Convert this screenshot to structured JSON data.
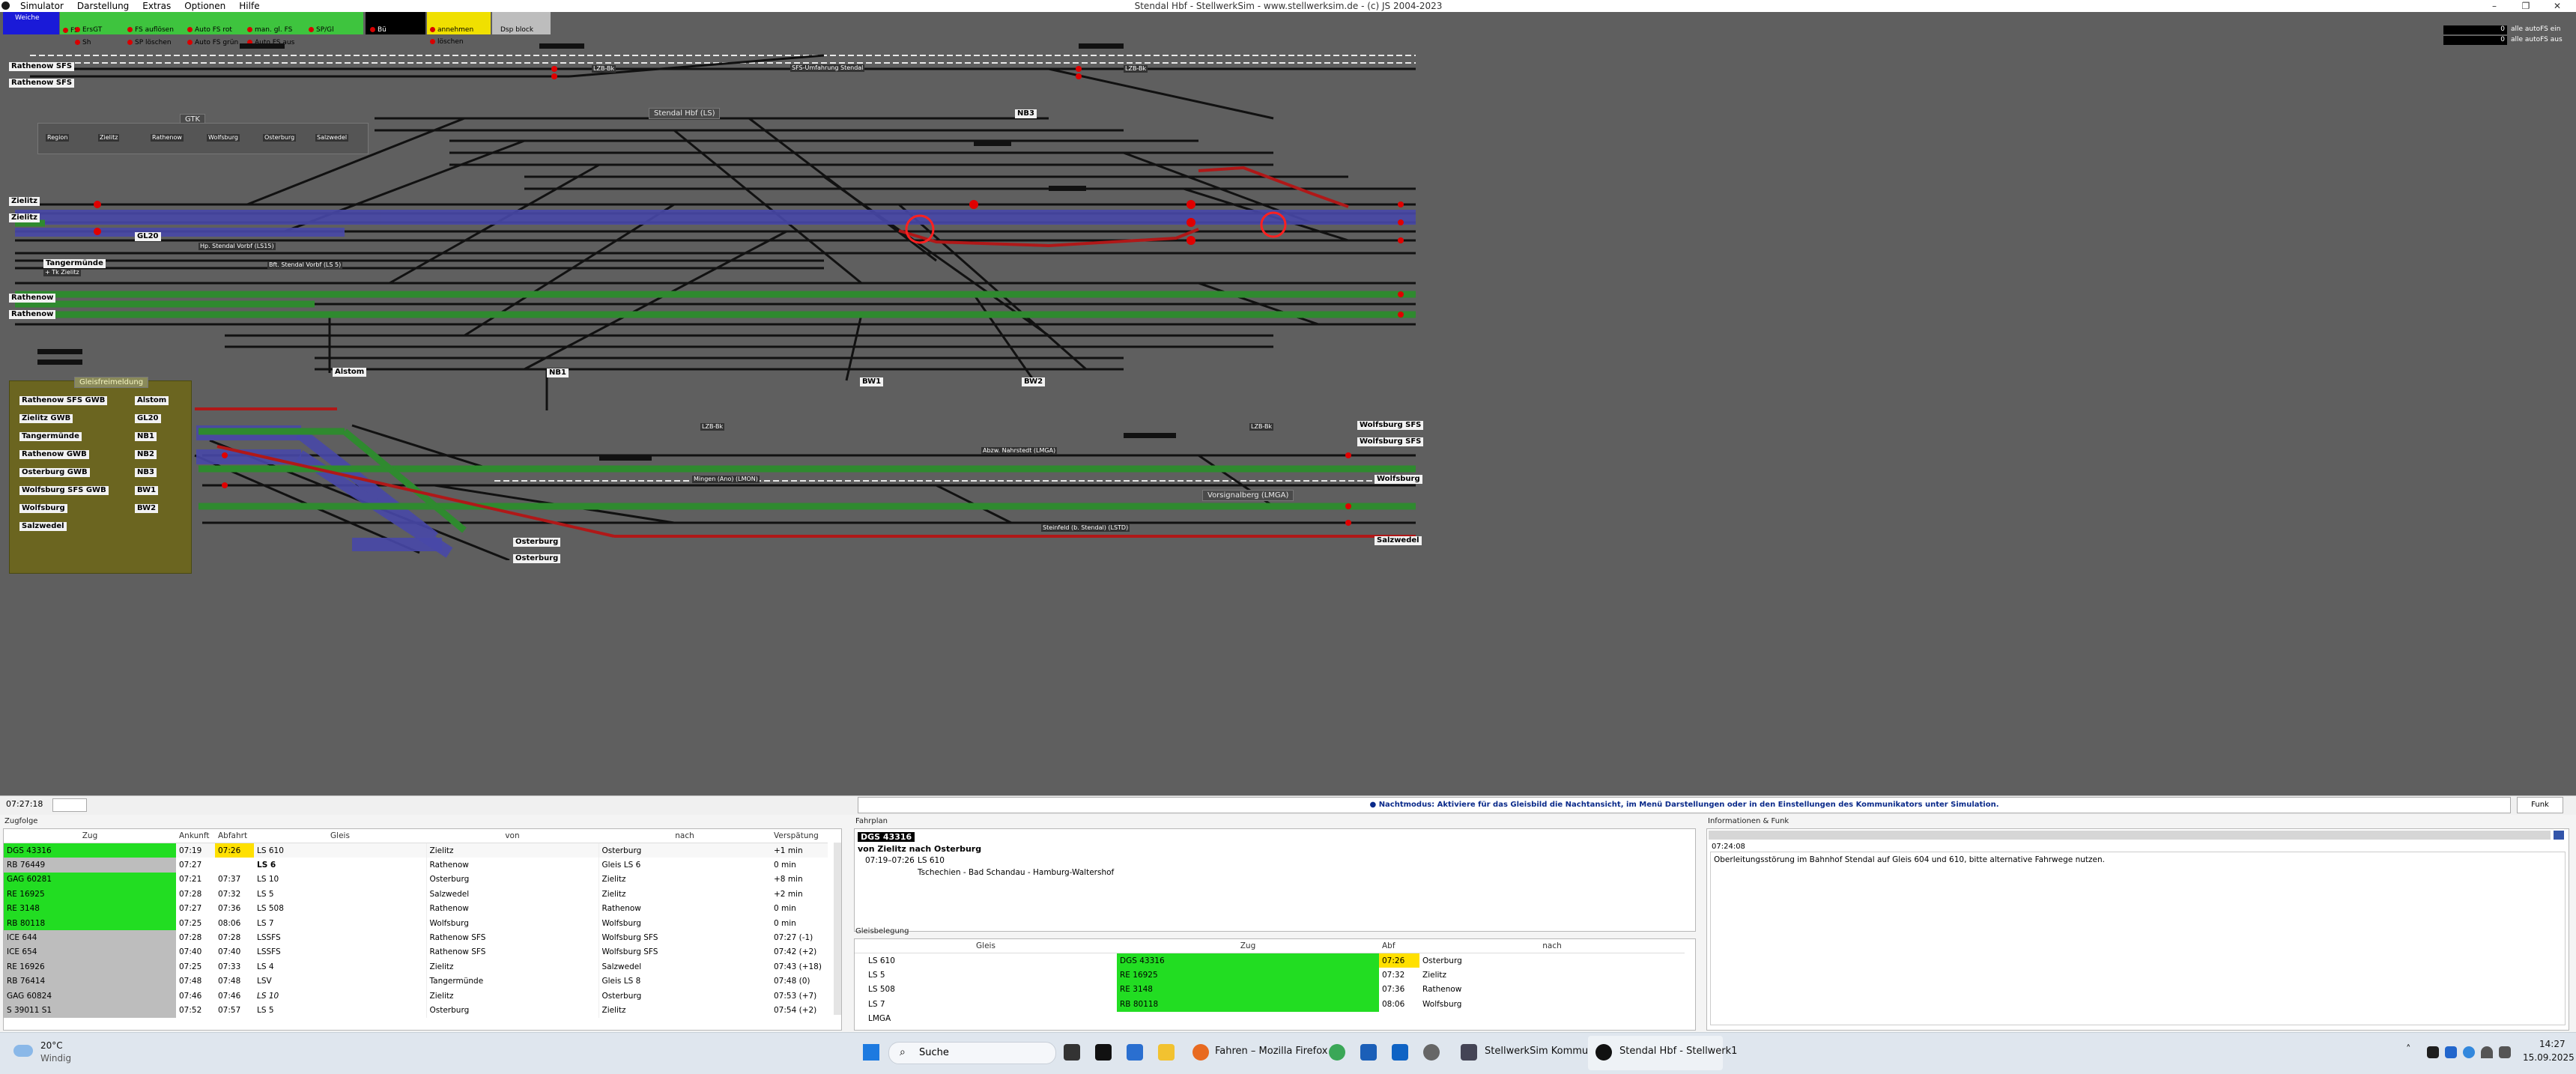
{
  "window": {
    "title": "Stendal Hbf - StellwerkSim - www.stellwerksim.de - (c) JS 2004-2023"
  },
  "menu": [
    "Simulator",
    "Darstellung",
    "Extras",
    "Optionen",
    "Hilfe"
  ],
  "toolbar": {
    "weiche": "Weiche",
    "fs": "FS",
    "ersgt": "ErsGT",
    "sh": "Sh",
    "fs_aufloesen": "FS auflösen",
    "sp_loeschen": "SP löschen",
    "auto_fs_rot": "Auto FS rot",
    "auto_fs_gruen": "Auto FS grün",
    "man_gl_fs": "man. gl. FS",
    "auto_fs_aus": "Auto FS aus",
    "sp_gl": "SP/Gl",
    "bu": "Bü",
    "annehmen": "annehmen",
    "loeschen": "löschen",
    "dsp_block": "Dsp block",
    "counter_1": "0",
    "counter_2": "0",
    "alle_autofs_ein": "alle autoFS ein",
    "alle_autofs_aus": "alle autoFS aus"
  },
  "map": {
    "stations_left": [
      "Rathenow SFS",
      "Rathenow SFS",
      "Zielitz",
      "Zielitz",
      "GL20",
      "Tangermünde",
      "Rathenow",
      "Rathenow"
    ],
    "tangermuende_sub": "+ Tk Zielitz",
    "stations_bottom": [
      "Alstom",
      "NB1",
      "BW1",
      "BW2",
      "NB3",
      "Osterburg",
      "Osterburg"
    ],
    "stations_right": [
      "Wolfsburg SFS",
      "Wolfsburg SFS",
      "Wolfsburg",
      "Salzwedel"
    ],
    "area_labels": [
      "Stendal Hbf (LS)",
      "Stendal Vorbhf (LS5)",
      "Vorsignalberg (LMGA)",
      "SFS-Umfahrung Stendal"
    ],
    "track_labels": [
      "Hp. Stendal Vorbf (LS15)",
      "Bft. Stendal Vorbf (LS 5)",
      "Mingen (Ano) (LMON)",
      "Abzw. Nahrstedt (LMGA)",
      "Steinfeld (b. Stendal) (LSTD)",
      "LZB-Bk",
      "LZB-Bk",
      "LZB-Bk",
      "LZB-Bk"
    ],
    "gtk_title": "GTK",
    "gtk_buttons": [
      "Region",
      "Zielitz",
      "Rathenow",
      "Wolfsburg",
      "Osterburg",
      "Salzwedel"
    ],
    "legend_title": "Gleisfreimeldung",
    "legend_left": [
      "Rathenow SFS GWB",
      "Zielitz GWB",
      "Tangermünde",
      "Rathenow GWB",
      "Osterburg GWB",
      "Wolfsburg SFS GWB",
      "Wolfsburg",
      "Salzwedel"
    ],
    "legend_right": [
      "Alstom",
      "GL20",
      "NB1",
      "NB2",
      "NB3",
      "BW1",
      "BW2"
    ]
  },
  "statusbar": {
    "time": "07:27:18",
    "message": "● Nachtmodus: Aktiviere für das Gleisbild die Nachtansicht, im Menü Darstellungen oder in den Einstellungen des Kommunikators unter Simulation.",
    "funk_button": "Funk"
  },
  "zugfolge": {
    "title": "Zugfolge",
    "headers": [
      "Zug",
      "Ankunft",
      "Abfahrt",
      "Gleis",
      "von",
      "nach",
      "Verspätung"
    ],
    "rows": [
      [
        "DGS 43316",
        "07:19",
        "07:26",
        "LS 610",
        "Zielitz",
        "Osterburg",
        "+1 min"
      ],
      [
        "RB 76449",
        "07:27",
        "",
        "LS 6",
        "Rathenow",
        "Gleis LS 6",
        "0 min"
      ],
      [
        "GAG 60281",
        "07:21",
        "07:37",
        "LS 10",
        "Osterburg",
        "Zielitz",
        "+8 min"
      ],
      [
        "RE 16925",
        "07:28",
        "07:32",
        "LS 5",
        "Salzwedel",
        "Zielitz",
        "+2 min"
      ],
      [
        "RE 3148",
        "07:27",
        "07:36",
        "LS 508",
        "Rathenow",
        "Rathenow",
        "0 min"
      ],
      [
        "RB 80118",
        "07:25",
        "08:06",
        "LS 7",
        "Wolfsburg",
        "Wolfsburg",
        "0 min"
      ],
      [
        "ICE 644",
        "07:28",
        "07:28",
        "LSSFS",
        "Rathenow SFS",
        "Wolfsburg SFS",
        "07:27 (-1)"
      ],
      [
        "ICE 654",
        "07:40",
        "07:40",
        "LSSFS",
        "Rathenow SFS",
        "Wolfsburg SFS",
        "07:42 (+2)"
      ],
      [
        "RE 16926",
        "07:25",
        "07:33",
        "LS 4",
        "Zielitz",
        "Salzwedel",
        "07:43 (+18)"
      ],
      [
        "RB 76414",
        "07:48",
        "07:48",
        "LSV",
        "Tangermünde",
        "Gleis LS 8",
        "07:48 (0)"
      ],
      [
        "GAG 60824",
        "07:46",
        "07:46",
        "LS 10",
        "Zielitz",
        "Osterburg",
        "07:53 (+7)"
      ],
      [
        "S 39011 S1",
        "07:52",
        "07:57",
        "LS 5",
        "Osterburg",
        "Zielitz",
        "07:54 (+2)"
      ]
    ]
  },
  "fahrplan": {
    "title": "Fahrplan",
    "train": "DGS 43316",
    "route": "von Zielitz nach Osterburg",
    "time": "07:19–07:26",
    "gleis": "LS 610",
    "info": "Tschechien - Bad Schandau - Hamburg-Waltershof"
  },
  "gleisbelegung": {
    "title": "Gleisbelegung",
    "headers": [
      "Gleis",
      "Zug",
      "Abf",
      "nach"
    ],
    "rows": [
      [
        "LS 610",
        "DGS 43316",
        "07:26",
        "Osterburg"
      ],
      [
        "LS 5",
        "RE 16925",
        "07:32",
        "Zielitz"
      ],
      [
        "LS 508",
        "RE 3148",
        "07:36",
        "Rathenow"
      ],
      [
        "LS 7",
        "RB 80118",
        "08:06",
        "Wolfsburg"
      ],
      [
        "LMGA",
        "",
        "",
        ""
      ]
    ]
  },
  "info": {
    "title": "Informationen & Funk",
    "time": "07:24:08",
    "message": "Oberleitungsstörung im Bahnhof Stendal auf Gleis 604 und 610, bitte alternative Fahrwege nutzen."
  },
  "taskbar": {
    "temp": "20°C",
    "weather": "Windig",
    "search": "Suche",
    "app_firefox": "Fahren – Mozilla Firefox",
    "app_komm": "StellwerkSim Kommunik",
    "app_stellwerk": "Stendal Hbf - Stellwerk1",
    "clock_time": "14:27",
    "clock_date": "15.09.2025"
  },
  "colors": {
    "track_bg": "#5f5f5f",
    "track": "#111111",
    "occupied_blue": "#4848a8",
    "route_green": "#2f8a2f",
    "route_red": "#b01818",
    "delay_yellow": "#ffe000",
    "row_green": "#22dd22",
    "row_gray": "#bdbdbd",
    "legend_bg": "#6b6520"
  }
}
